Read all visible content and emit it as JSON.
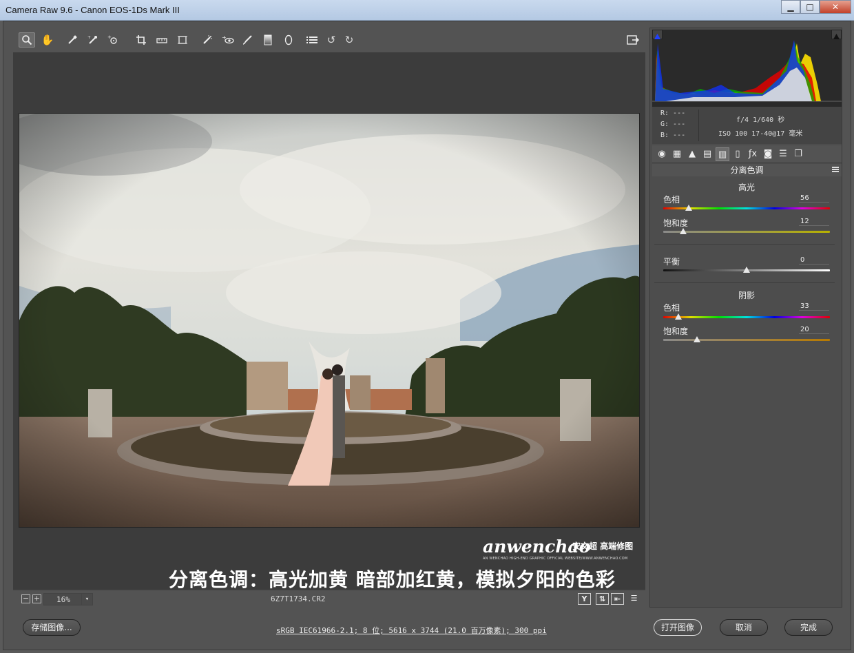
{
  "window": {
    "title": "Camera Raw 9.6 -  Canon EOS-1Ds Mark III"
  },
  "toolbar": {
    "tools": [
      "zoom-icon",
      "hand-icon",
      "white-balance-icon",
      "color-sampler-icon",
      "targeted-adjustment-icon",
      "crop-icon",
      "straighten-icon",
      "transform-icon",
      "spot-removal-icon",
      "red-eye-icon",
      "adjustment-brush-icon",
      "graduated-filter-icon",
      "radial-filter-icon",
      "preferences-icon",
      "rotate-left-icon",
      "rotate-right-icon"
    ],
    "fullscreen_icon": "fullscreen-icon"
  },
  "preview": {
    "watermark_brand": "anwenchao",
    "watermark_cn": "安文超 高端修图",
    "watermark_sub": "AN WENCHAO HIGH-END GRAPHIC OFFICIAL WEBSITE/WWW.ANWENCHAO.COM",
    "caption": "分离色调：高光加黄 暗部加红黄，模拟夕阳的色彩"
  },
  "statusbar": {
    "zoom": "16%",
    "filename": "6Z7T1734.CR2"
  },
  "info": {
    "r": "R:  ---",
    "g": "G:  ---",
    "b": "B:  ---",
    "aperture_shutter": "f/4   1/640 秒",
    "iso_lens": "ISO 100   17-40@17 毫米"
  },
  "panel": {
    "title": "分离色调",
    "highlights": {
      "title": "高光",
      "hue_label": "色相",
      "hue_value": "56",
      "sat_label": "饱和度",
      "sat_value": "12"
    },
    "balance": {
      "label": "平衡",
      "value": "0"
    },
    "shadows": {
      "title": "阴影",
      "hue_label": "色相",
      "hue_value": "33",
      "sat_label": "饱和度",
      "sat_value": "20"
    }
  },
  "footer": {
    "save_label": "存储图像...",
    "workflow_link": "sRGB IEC61966-2.1; 8 位; 5616 x 3744 (21.0 百万像素); 300 ppi",
    "open_label": "打开图像",
    "cancel_label": "取消",
    "done_label": "完成"
  }
}
